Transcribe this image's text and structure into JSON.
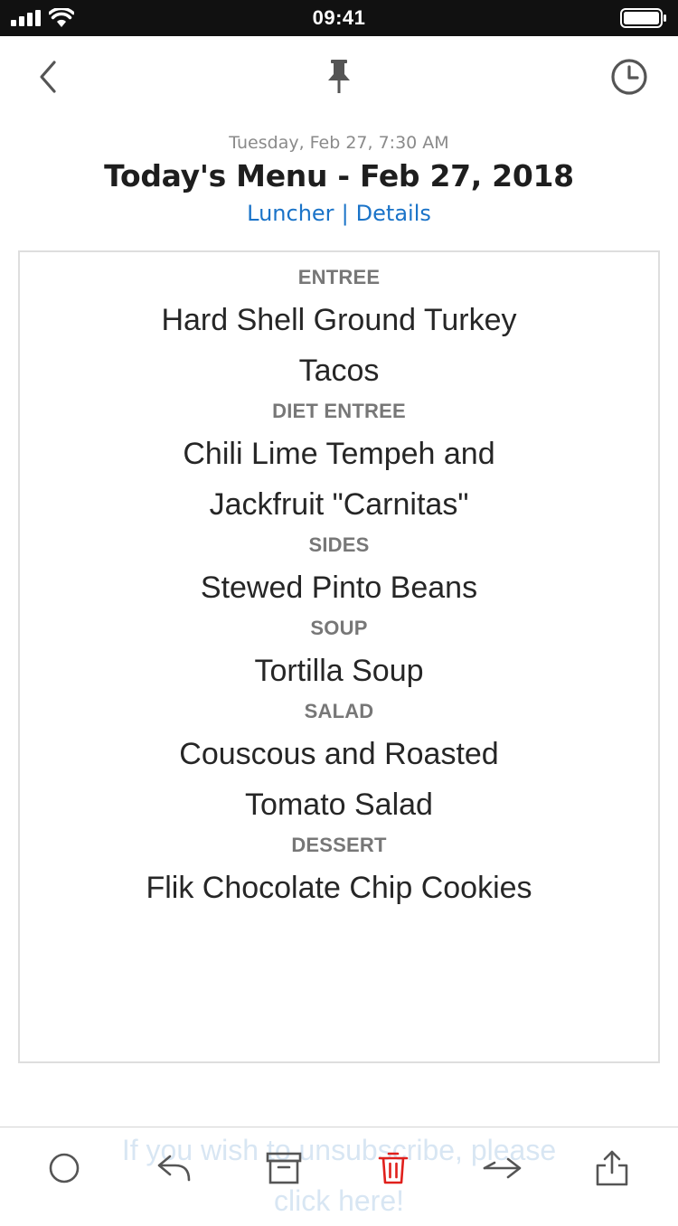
{
  "status": {
    "time": "09:41"
  },
  "message": {
    "date": "Tuesday, Feb 27, 7:30 AM",
    "subject": "Today's Menu - Feb 27, 2018",
    "sender": "Luncher",
    "separator": "|",
    "details_link": "Details"
  },
  "menu": [
    {
      "label": "ENTREE",
      "dishes": [
        "Hard Shell Ground Turkey",
        "Tacos"
      ]
    },
    {
      "label": "DIET ENTREE",
      "dishes": [
        "Chili Lime Tempeh and",
        "Jackfruit \"Carnitas\""
      ]
    },
    {
      "label": "SIDES",
      "dishes": [
        "Stewed Pinto Beans"
      ]
    },
    {
      "label": "SOUP",
      "dishes": [
        "Tortilla Soup"
      ]
    },
    {
      "label": "SALAD",
      "dishes": [
        "Couscous and Roasted",
        "Tomato Salad"
      ]
    },
    {
      "label": "DESSERT",
      "dishes": [
        "Flik Chocolate Chip Cookies"
      ]
    }
  ],
  "footer": {
    "unsubscribe_line1": "If you wish to unsubscribe, please",
    "unsubscribe_line2": "click here!"
  },
  "toolbar": {
    "icons": [
      "circle-icon",
      "reply-icon",
      "archive-icon",
      "trash-icon",
      "forward-icon",
      "share-icon"
    ]
  },
  "colors": {
    "link": "#1a73c8",
    "delete": "#e0201c",
    "status_bar": "#111111",
    "icon": "#555555"
  }
}
